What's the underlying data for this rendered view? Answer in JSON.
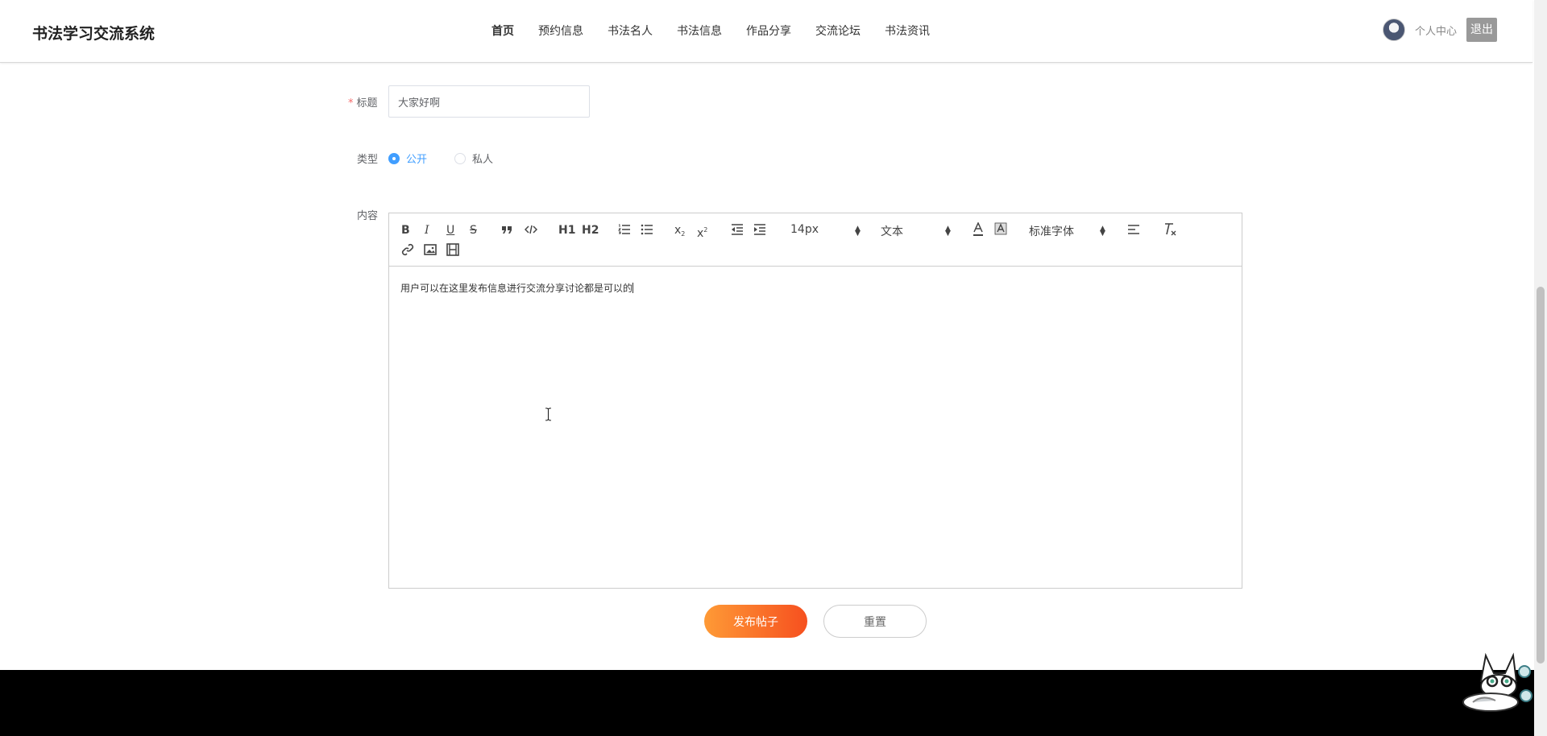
{
  "header": {
    "brand": "书法学习交流系统",
    "nav": [
      {
        "label": "首页"
      },
      {
        "label": "预约信息"
      },
      {
        "label": "书法名人"
      },
      {
        "label": "书法信息"
      },
      {
        "label": "作品分享"
      },
      {
        "label": "交流论坛"
      },
      {
        "label": "书法资讯"
      }
    ],
    "user_center": "个人中心",
    "logout": "退出"
  },
  "form": {
    "title_label": "标题",
    "title_required_mark": "*",
    "title_value": "大家好啊",
    "type_label": "类型",
    "type_options": [
      {
        "label": "公开",
        "checked": true
      },
      {
        "label": "私人",
        "checked": false
      }
    ],
    "content_label": "内容",
    "content_text": "用户可以在这里发布信息进行交流分享讨论都是可以的"
  },
  "toolbar": {
    "bold": "B",
    "italic": "I",
    "underline": "U",
    "strike": "S",
    "h1": "H1",
    "h2": "H2",
    "size_value": "14px",
    "header_value": "文本",
    "font_value": "标准字体",
    "icons": [
      "bold-icon",
      "italic-icon",
      "underline-icon",
      "strike-icon",
      "blockquote-icon",
      "code-block-icon",
      "header1-icon",
      "header2-icon",
      "ordered-list-icon",
      "bullet-list-icon",
      "subscript-icon",
      "superscript-icon",
      "outdent-icon",
      "indent-icon",
      "font-color-icon",
      "background-color-icon",
      "align-icon",
      "clean-format-icon",
      "link-icon",
      "image-icon",
      "video-icon"
    ]
  },
  "actions": {
    "submit": "发布帖子",
    "reset": "重置"
  },
  "colors": {
    "accent": "#409eff",
    "submit_start": "#fe9a36",
    "submit_end": "#f6501f",
    "footer": "#000000"
  }
}
